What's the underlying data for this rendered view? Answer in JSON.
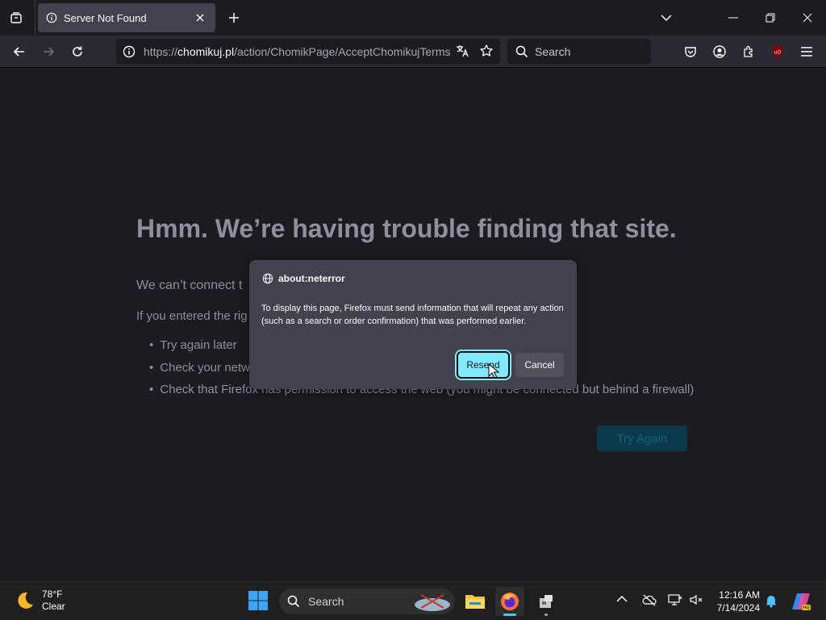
{
  "tab": {
    "title": "Server Not Found"
  },
  "navbar": {
    "url_scheme": "https://",
    "url_domain": "chomikuj.pl",
    "url_path": "/action/ChomikPage/AcceptChomikujTerms",
    "search_placeholder": "Search"
  },
  "page": {
    "title": "Hmm. We’re having trouble finding that site.",
    "line1": "We can’t connect t",
    "line2": "If you entered the rig",
    "bullets": [
      "Try again later",
      "Check your netw",
      "Check that Firefox has permission to access the web (you might be connected but behind a firewall)"
    ],
    "try_again_label": "Try Again"
  },
  "dialog": {
    "title": "about:neterror",
    "message": "To display this page, Firefox must send information that will repeat any action (such as a search or order confirmation) that was performed earlier.",
    "resend_label": "Resend",
    "cancel_label": "Cancel"
  },
  "taskbar": {
    "temperature": "78°F",
    "condition": "Clear",
    "search_placeholder": "Search",
    "time": "12:16 AM",
    "date": "7/14/2024"
  },
  "colors": {
    "accent": "#80ebff",
    "page_bg": "#1c1b22",
    "toolbar_bg": "#2b2a33",
    "dialog_bg": "#42414d"
  },
  "icons": [
    "tab-list-icon",
    "info-icon",
    "close-icon",
    "plus-icon",
    "chevron-down-icon",
    "minimize-icon",
    "restore-icon",
    "back-arrow-icon",
    "forward-arrow-icon",
    "reload-icon",
    "translate-icon",
    "star-icon",
    "search-icon",
    "pocket-icon",
    "account-icon",
    "extensions-icon",
    "ublock-icon",
    "menu-icon",
    "globe-icon",
    "moon-icon",
    "windows-start-icon",
    "file-explorer-icon",
    "firefox-icon",
    "app-icon",
    "chevron-up-icon",
    "network-icon",
    "display-icon",
    "volume-mute-icon",
    "bell-icon",
    "copilot-icon"
  ]
}
